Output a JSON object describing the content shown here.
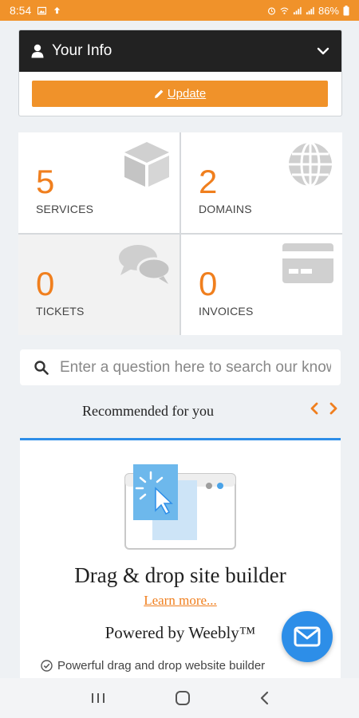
{
  "status_bar": {
    "time": "8:54",
    "battery": "86%",
    "icons": [
      "image-icon",
      "upload-icon",
      "alarm-icon",
      "wifi-icon",
      "signal-icon",
      "signal-icon",
      "battery-icon"
    ]
  },
  "info_card": {
    "title": "Your Info",
    "update_label": "Update",
    "icons": [
      "user-icon",
      "chevron-down-icon",
      "pencil-icon"
    ]
  },
  "stats": [
    {
      "value": "5",
      "label": "SERVICES",
      "icon": "cube-icon"
    },
    {
      "value": "2",
      "label": "DOMAINS",
      "icon": "globe-icon"
    },
    {
      "value": "0",
      "label": "TICKETS",
      "icon": "chat-bubbles-icon"
    },
    {
      "value": "0",
      "label": "INVOICES",
      "icon": "credit-card-icon"
    }
  ],
  "search": {
    "placeholder": "Enter a question here to search our knowledge base"
  },
  "recommended": {
    "title": "Recommended for you",
    "card": {
      "title": "Drag & drop site builder",
      "learn_more": "Learn more...",
      "powered_by": "Powered by Weebly™",
      "feature": "Powerful drag and drop website builder"
    }
  },
  "colors": {
    "accent": "#f0922a",
    "number": "#f07f1e",
    "blue": "#2d8ee8",
    "header_dark": "#222222"
  }
}
